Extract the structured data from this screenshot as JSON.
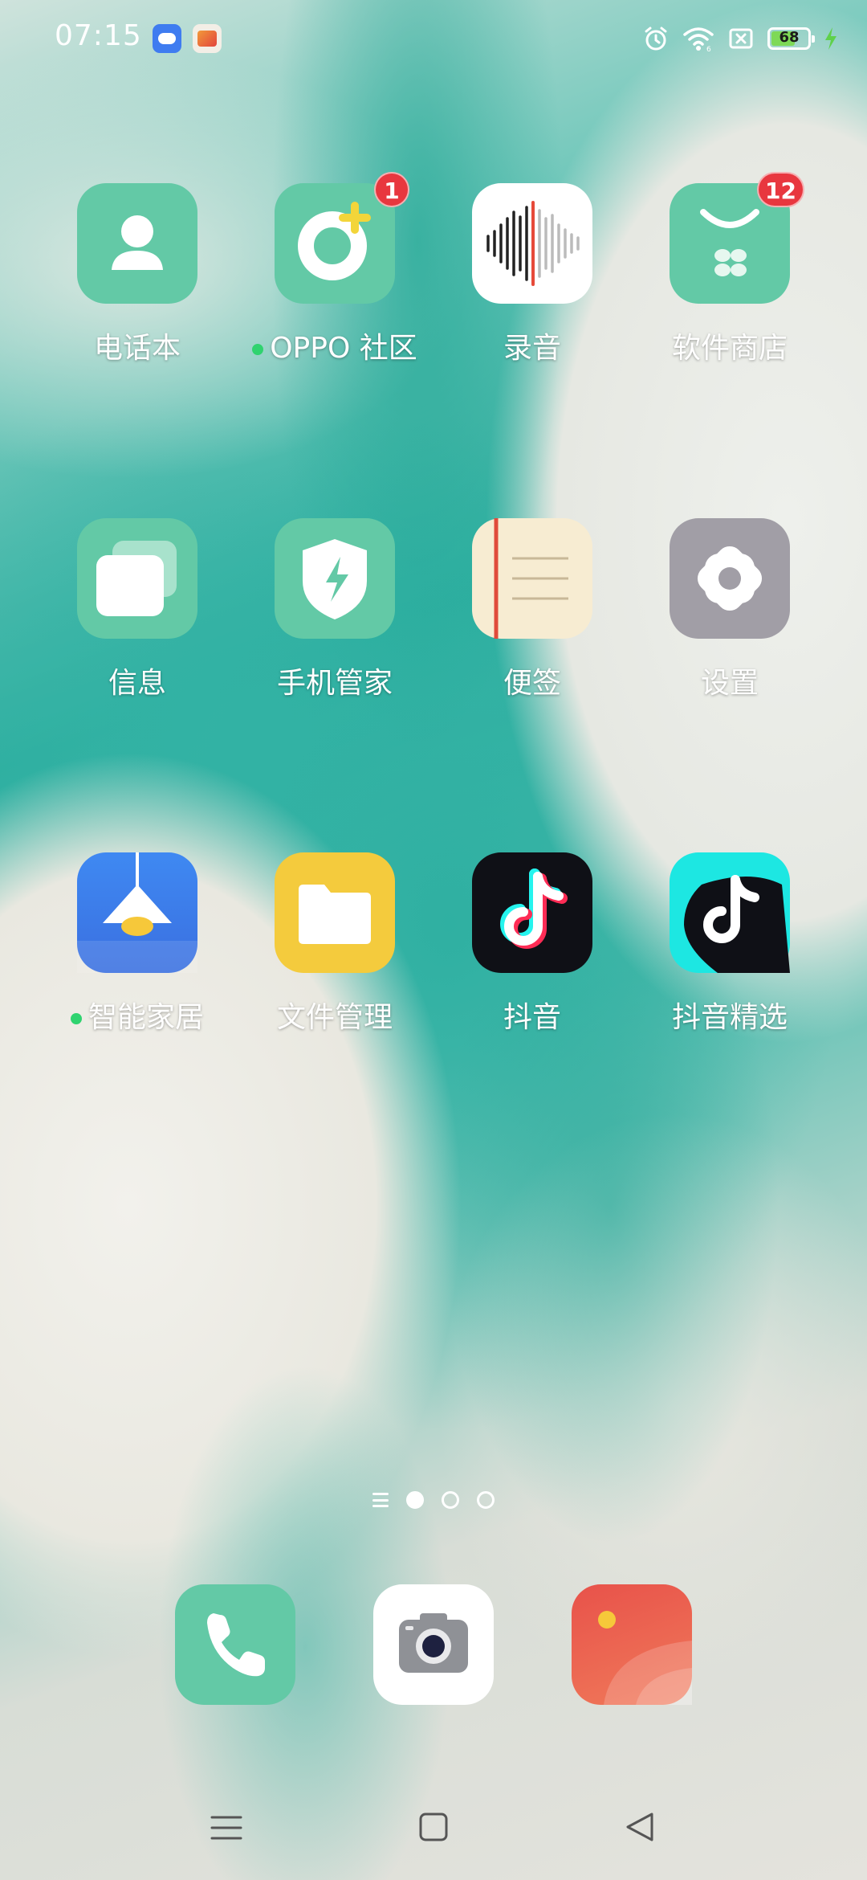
{
  "status_bar": {
    "time": "07:15",
    "notification_icons": [
      "cloud-sync-icon",
      "game-app-icon"
    ],
    "system_icons": [
      "alarm-icon",
      "wifi-icon",
      "no-sim-icon",
      "battery-icon",
      "charging-icon"
    ],
    "battery_level": 68,
    "battery_text": "68"
  },
  "apps": [
    {
      "label": "电话本",
      "icon": "contacts-icon",
      "badge": null,
      "new_dot": false
    },
    {
      "label": "OPPO 社区",
      "icon": "oppo-community-icon",
      "badge": "1",
      "new_dot": true
    },
    {
      "label": "录音",
      "icon": "recorder-icon",
      "badge": null,
      "new_dot": false
    },
    {
      "label": "软件商店",
      "icon": "app-store-icon",
      "badge": "12",
      "new_dot": false
    },
    {
      "label": "信息",
      "icon": "messages-icon",
      "badge": null,
      "new_dot": false
    },
    {
      "label": "手机管家",
      "icon": "phone-manager-icon",
      "badge": null,
      "new_dot": false
    },
    {
      "label": "便签",
      "icon": "notes-icon",
      "badge": null,
      "new_dot": false
    },
    {
      "label": "设置",
      "icon": "settings-icon",
      "badge": null,
      "new_dot": false
    },
    {
      "label": "智能家居",
      "icon": "smart-home-icon",
      "badge": null,
      "new_dot": true
    },
    {
      "label": "文件管理",
      "icon": "file-manager-icon",
      "badge": null,
      "new_dot": false
    },
    {
      "label": "抖音",
      "icon": "douyin-icon",
      "badge": null,
      "new_dot": false
    },
    {
      "label": "抖音精选",
      "icon": "douyin-select-icon",
      "badge": null,
      "new_dot": false
    }
  ],
  "page_indicator": {
    "pages": 3,
    "current": 1
  },
  "dock": [
    "phone-icon",
    "camera-icon",
    "gallery-icon"
  ],
  "nav_bar": [
    "recents-icon",
    "home-icon",
    "back-icon"
  ],
  "colors": {
    "accent_mint": "#63c9a6",
    "badge_red": "#e8373f",
    "new_dot_green": "#2fd36f"
  }
}
